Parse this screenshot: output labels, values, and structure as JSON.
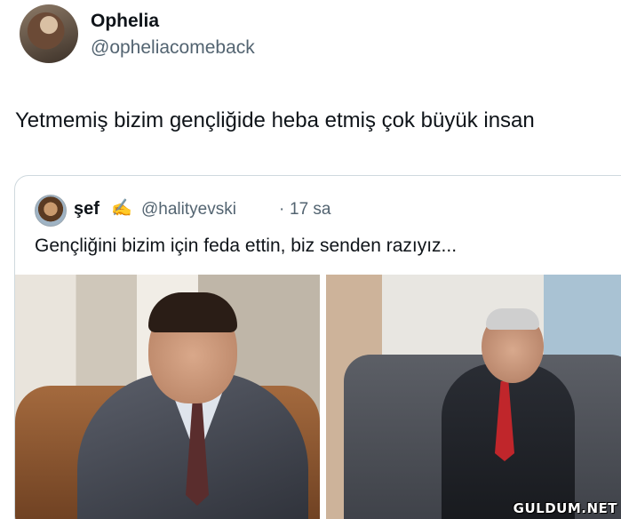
{
  "author": {
    "display_name": "Ophelia",
    "handle": "@opheliacomeback"
  },
  "tweet": {
    "text": "Yetmemiş bizim gençliğide heba etmiş çok büyük insan"
  },
  "quoted_tweet": {
    "display_name": "şef",
    "name_emoji": "✍️",
    "handle": "@halityevski",
    "separator": "·",
    "time": "17 sa",
    "text": "Gençliğini bizim için feda ettin, biz senden razıyız...",
    "media": [
      {
        "kind": "photo",
        "icon": "photo-vintage-portrait"
      },
      {
        "kind": "photo",
        "icon": "photo-seated-on-sofa"
      }
    ]
  },
  "watermark": "GULDUM.NET"
}
